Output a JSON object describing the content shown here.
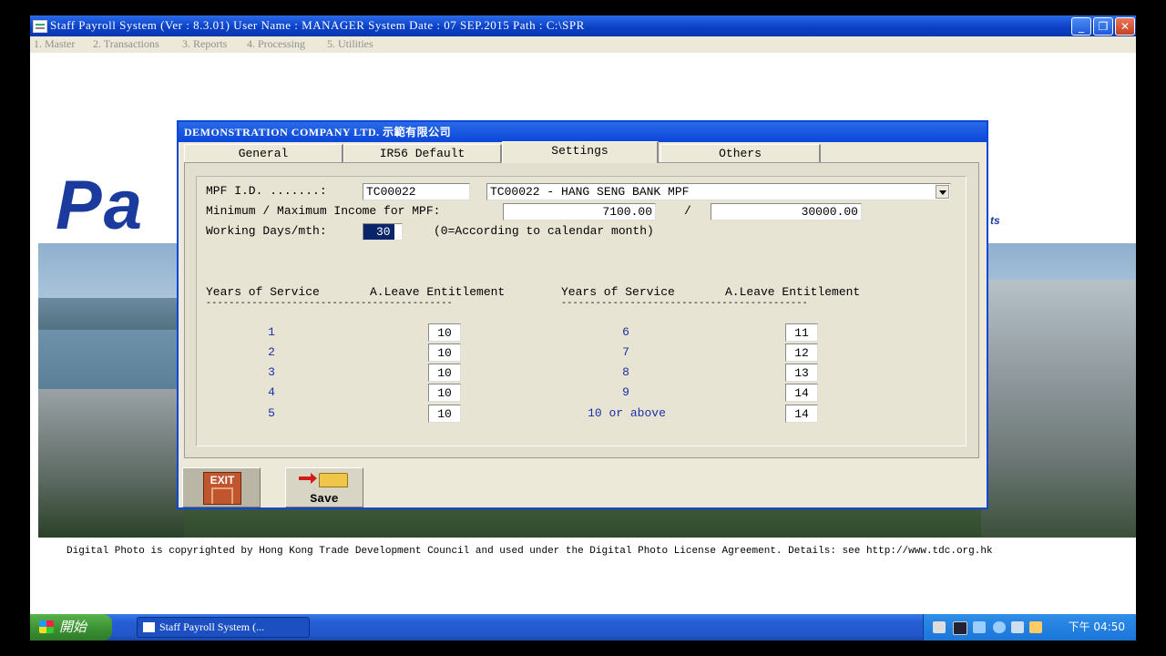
{
  "window": {
    "title": "Staff Payroll System (Ver : 8.3.01)  User Name : MANAGER  System Date : 07 SEP.2015  Path : C:\\SPR",
    "minimize": "_",
    "maximize": "❐",
    "close": "✕"
  },
  "menu": [
    "1. Master",
    "2. Transactions",
    "3. Reports",
    "4. Processing",
    "5. Utilities"
  ],
  "background": {
    "logo_text": "Pa",
    "logo_tail": "ts",
    "copyright": "Digital Photo is copyrighted by Hong Kong Trade Development Council and used under the Digital Photo License Agreement. Details: see http://www.tdc.org.hk"
  },
  "dialog": {
    "title": "DEMONSTRATION COMPANY LTD. 示範有限公司",
    "tabs": [
      "General",
      "IR56 Default",
      "Settings",
      "Others"
    ],
    "active_tab": "Settings",
    "mpf_id_label": "MPF I.D. .......:",
    "mpf_id_value": "TC00022",
    "mpf_scheme_value": "TC00022     - HANG SENG BANK MPF",
    "income_label": "Minimum / Maximum Income for MPF:",
    "min_income": "7100.00",
    "income_sep": "/",
    "max_income": "30000.00",
    "working_days_label": "Working Days/mth:",
    "working_days_value": "30",
    "working_days_note": "(0=According to calendar month)",
    "col_years": "Years of Service",
    "col_leave": "A.Leave Entitlement",
    "divider": "-------------------------------------------",
    "left_rows": [
      {
        "years": "1",
        "leave": "10"
      },
      {
        "years": "2",
        "leave": "10"
      },
      {
        "years": "3",
        "leave": "10"
      },
      {
        "years": "4",
        "leave": "10"
      },
      {
        "years": "5",
        "leave": "10"
      }
    ],
    "right_rows": [
      {
        "years": "6",
        "leave": "11"
      },
      {
        "years": "7",
        "leave": "12"
      },
      {
        "years": "8",
        "leave": "13"
      },
      {
        "years": "9",
        "leave": "14"
      },
      {
        "years": "10 or above",
        "leave": "14"
      }
    ],
    "exit_label": "EXIT",
    "save_label": "Save"
  },
  "taskbar": {
    "start_label": "開始",
    "task_label": "Staff Payroll System (...",
    "clock": "下午 04:50"
  }
}
